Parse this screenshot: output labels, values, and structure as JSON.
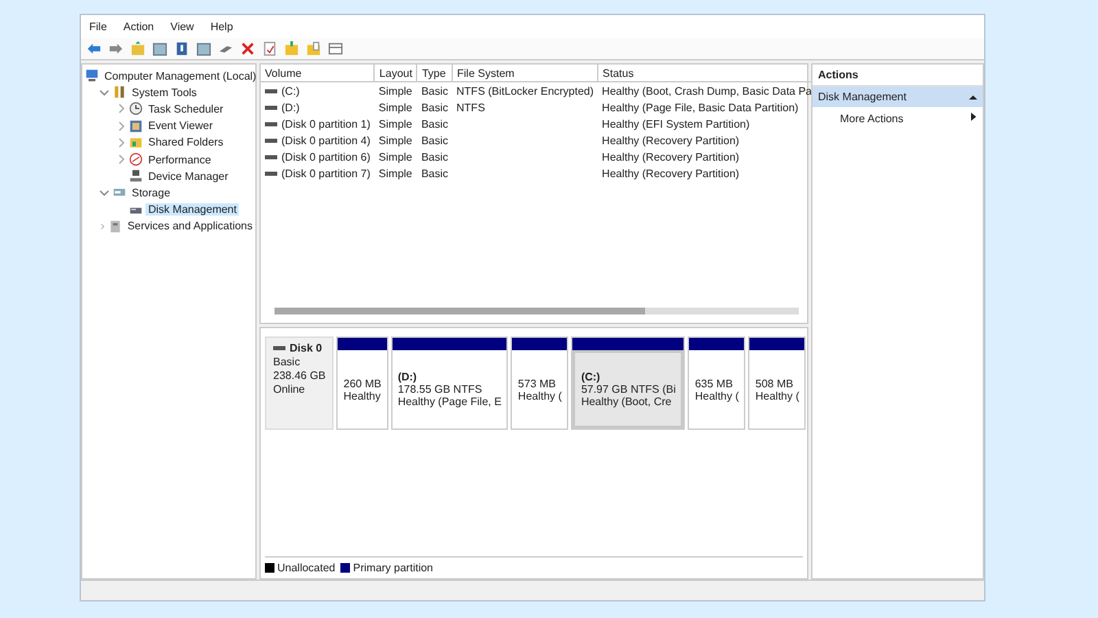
{
  "menu": [
    "File",
    "Action",
    "View",
    "Help"
  ],
  "tree": [
    {
      "label": "Computer Management (Local)",
      "kind": "computer",
      "selected": false,
      "children": [
        {
          "label": "System Tools",
          "kind": "tools",
          "selected": false,
          "expanded": true,
          "children": [
            {
              "label": "Task Scheduler",
              "kind": "clock",
              "selected": false,
              "expanded": false
            },
            {
              "label": "Event Viewer",
              "kind": "log",
              "selected": false,
              "expanded": false
            },
            {
              "label": "Shared Folders",
              "kind": "share",
              "selected": false,
              "expanded": false
            },
            {
              "label": "Performance",
              "kind": "gauge",
              "selected": false,
              "expanded": false
            },
            {
              "label": "Device Manager",
              "kind": "device",
              "selected": false
            }
          ]
        },
        {
          "label": "Storage",
          "kind": "storage",
          "selected": false,
          "expanded": true,
          "children": [
            {
              "label": "Disk Management",
              "kind": "disk",
              "selected": true
            }
          ]
        },
        {
          "label": "Services and Applications",
          "kind": "services",
          "selected": false,
          "expanded": false
        }
      ]
    }
  ],
  "table": {
    "columns": [
      "Volume",
      "Layout",
      "Type",
      "File System",
      "Status"
    ],
    "rows": [
      [
        "(C:)",
        "Simple",
        "Basic",
        "NTFS (BitLocker Encrypted)",
        "Healthy (Boot, Crash Dump, Basic Data Pa"
      ],
      [
        "(D:)",
        "Simple",
        "Basic",
        "NTFS",
        "Healthy (Page File, Basic Data Partition)"
      ],
      [
        "(Disk 0 partition 1)",
        "Simple",
        "Basic",
        "",
        "Healthy (EFI System Partition)"
      ],
      [
        "(Disk 0 partition 4)",
        "Simple",
        "Basic",
        "",
        "Healthy (Recovery Partition)"
      ],
      [
        "(Disk 0 partition 6)",
        "Simple",
        "Basic",
        "",
        "Healthy (Recovery Partition)"
      ],
      [
        "(Disk 0 partition 7)",
        "Simple",
        "Basic",
        "",
        "Healthy (Recovery Partition)"
      ]
    ]
  },
  "disk": {
    "name": "Disk 0",
    "type": "Basic",
    "size": "238.46 GB",
    "status": "Online",
    "partitions": [
      {
        "size": "260 MB",
        "status": "Healthy",
        "selected": false
      },
      {
        "title": "(D:)",
        "size": "178.55 GB NTFS",
        "status": "Healthy (Page File, E",
        "selected": false
      },
      {
        "size": "573 MB",
        "status": "Healthy (",
        "selected": false
      },
      {
        "title": "(C:)",
        "size": "57.97 GB NTFS (Bi",
        "status": "Healthy (Boot, Cre",
        "selected": true
      },
      {
        "size": "635 MB",
        "status": "Healthy (",
        "selected": false
      },
      {
        "size": "508 MB",
        "status": "Healthy (",
        "selected": false
      }
    ]
  },
  "legend": [
    {
      "label": "Unallocated",
      "color": "#000000"
    },
    {
      "label": "Primary partition",
      "color": "#000080"
    }
  ],
  "actions": {
    "title": "Actions",
    "sections": [
      {
        "label": "Disk Management",
        "expanded": true,
        "items": [
          {
            "label": "More Actions"
          }
        ]
      }
    ]
  }
}
